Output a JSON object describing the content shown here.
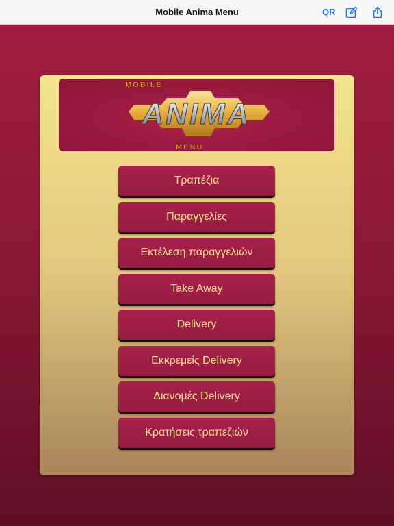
{
  "nav": {
    "title": "Mobile Anima Menu",
    "qr_label": "QR",
    "icons": [
      "compose-icon",
      "share-icon"
    ],
    "accent_color": "#1a73e8"
  },
  "logo": {
    "top_text": "MOBILE",
    "main_text": "ANIMA",
    "bottom_text": "MENU"
  },
  "menu": {
    "items": [
      {
        "label": "Τραπέζια"
      },
      {
        "label": "Παραγγελίες"
      },
      {
        "label": "Εκτέλεση παραγγελιών"
      },
      {
        "label": "Take Away"
      },
      {
        "label": "Delivery"
      },
      {
        "label": "Εκκρεμείς Delivery"
      },
      {
        "label": "Διανομές Delivery"
      },
      {
        "label": "Κρατήσεις τραπεζιών"
      }
    ]
  },
  "colors": {
    "background": "#8c1837",
    "panel": "#e3c67e",
    "button": "#9e1d45",
    "button_text": "#f5e28f"
  }
}
